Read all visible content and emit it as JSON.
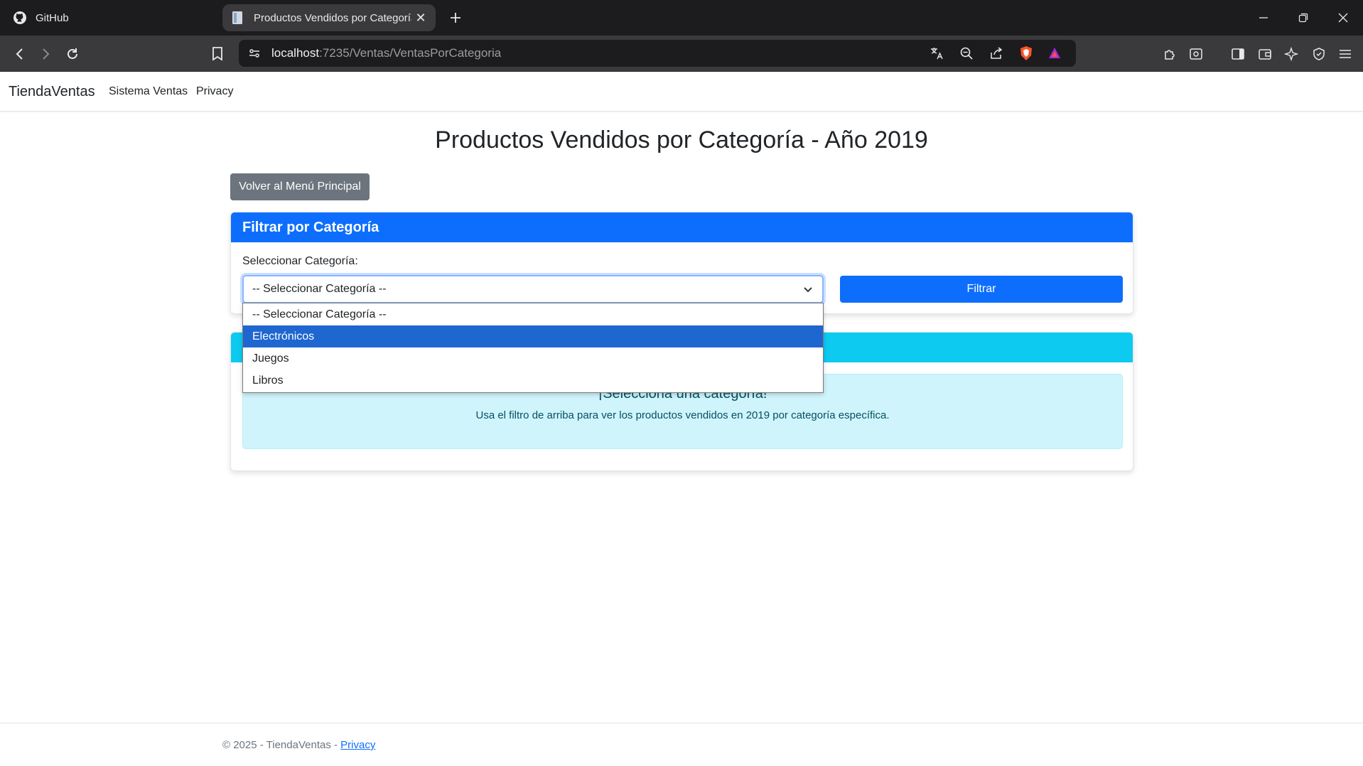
{
  "browser": {
    "tabs": [
      {
        "title": "GitHub",
        "icon": "github-icon"
      },
      {
        "title": "Productos Vendidos por Categoría",
        "icon": "page-icon"
      }
    ],
    "url_host": "localhost",
    "url_path": ":7235/Ventas/VentasPorCategoria"
  },
  "navbar": {
    "brand": "TiendaVentas",
    "links": [
      "Sistema Ventas",
      "Privacy"
    ]
  },
  "main": {
    "title": "Productos Vendidos por Categoría - Año 2019",
    "back_button": "Volver al Menú Principal",
    "filter_card": {
      "header": "Filtrar por Categoría",
      "label": "Seleccionar Categoría:",
      "selected_value": "-- Seleccionar Categoría --",
      "filter_button": "Filtrar",
      "options": [
        "-- Seleccionar Categoría --",
        "Electrónicos",
        "Juegos",
        "Libros"
      ],
      "highlighted_option": "Electrónicos"
    },
    "info_card": {
      "alert_title": "¡Selecciona una categoría!",
      "alert_text": "Usa el filtro de arriba para ver los productos vendidos en 2019 por categoría específica."
    }
  },
  "footer": {
    "text": "© 2025 - TiendaVentas - ",
    "link": "Privacy"
  },
  "colors": {
    "primary": "#0d6efd",
    "info": "#0dcaf0",
    "secondary": "#6c757d",
    "alert_bg": "#cff4fc"
  }
}
